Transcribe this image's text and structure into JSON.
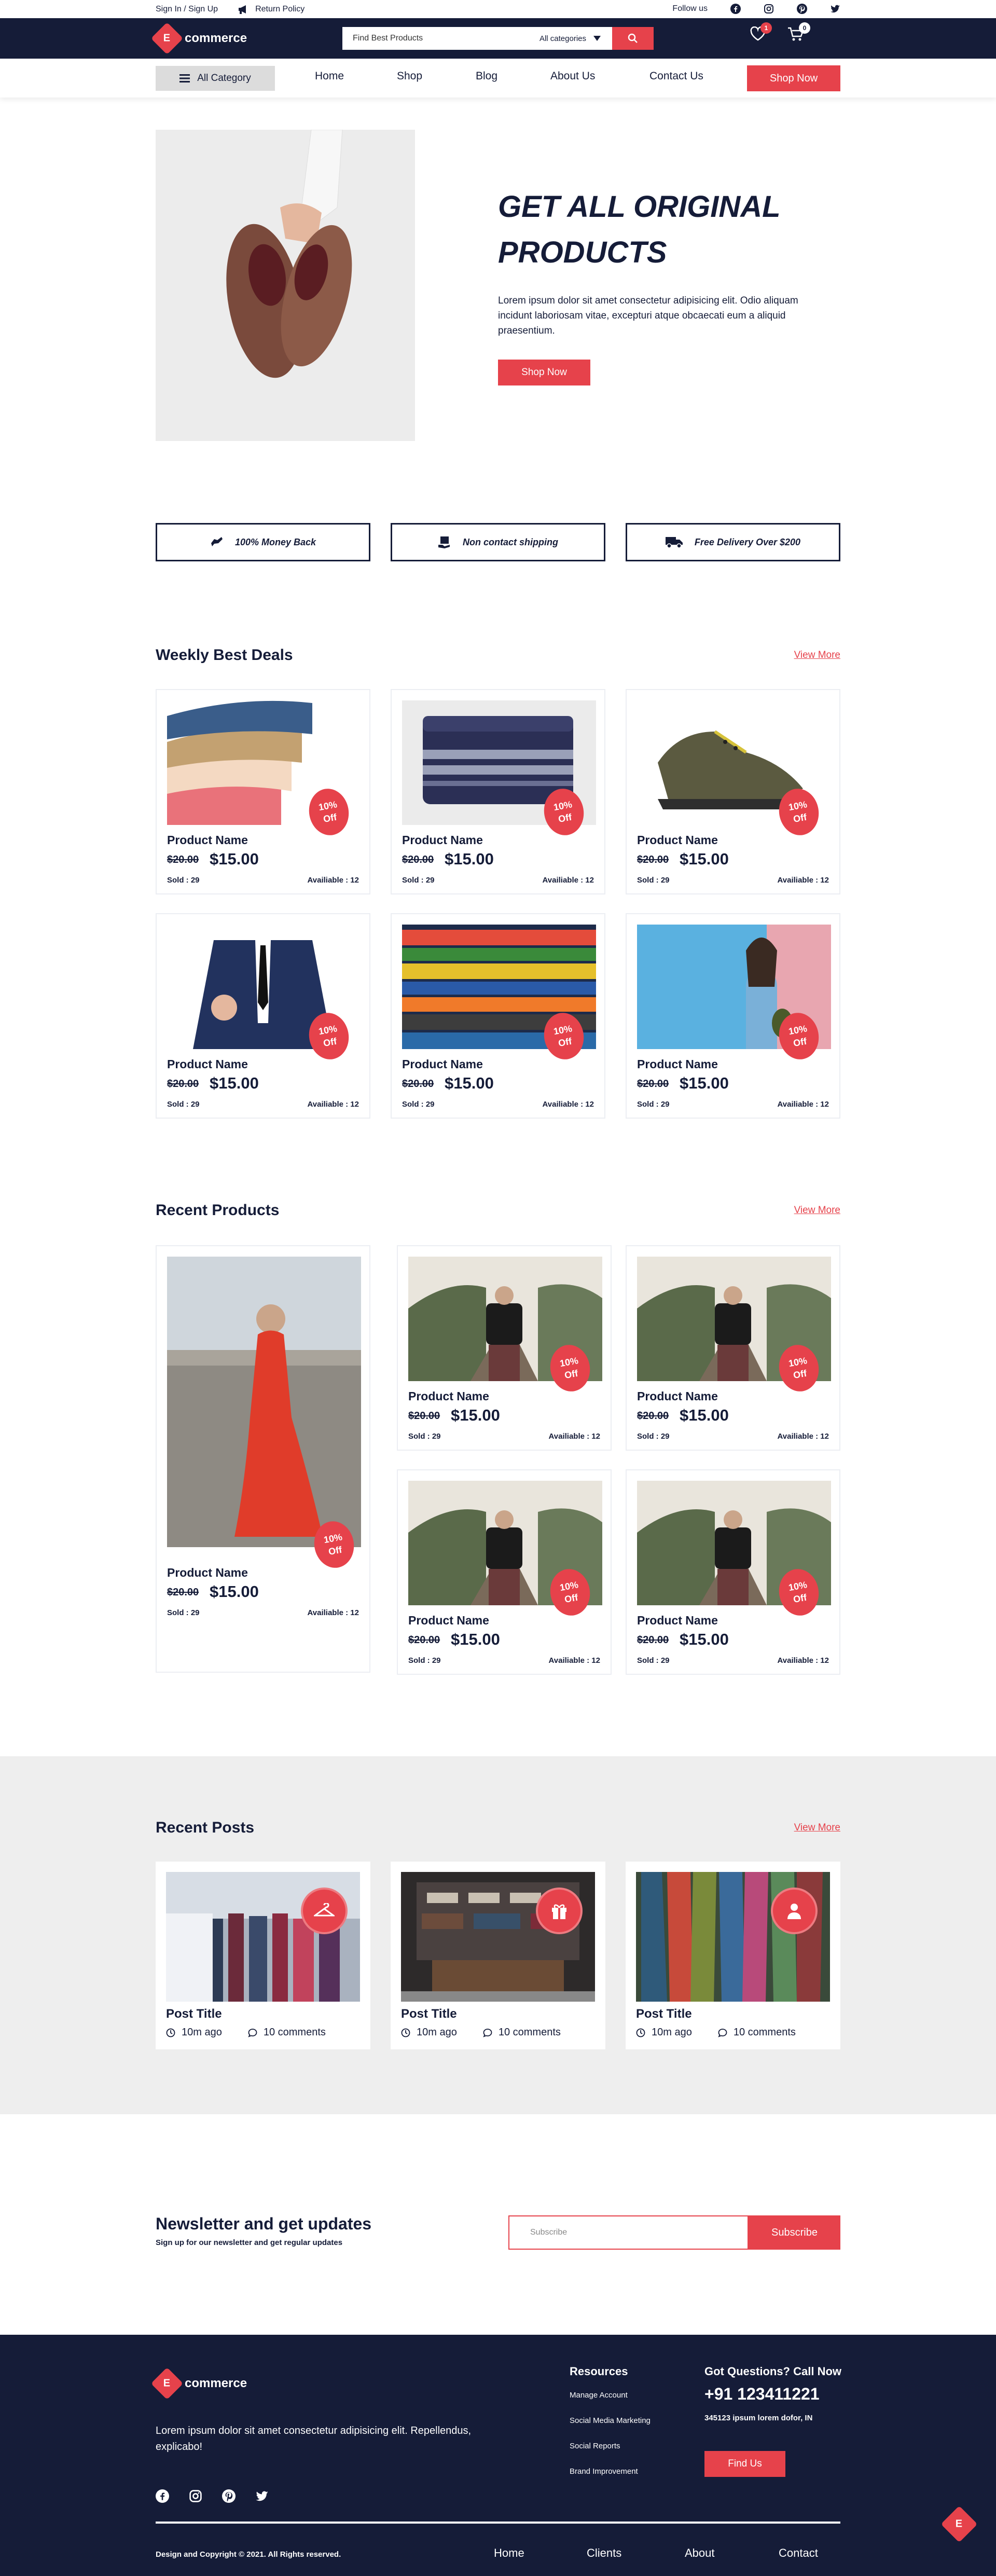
{
  "topbar": {
    "signin": "Sign In / Sign Up",
    "return": "Return Policy",
    "follow": "Follow us"
  },
  "brand": {
    "letter": "E",
    "name": "commerce"
  },
  "search": {
    "placeholder": "Find Best Products",
    "category": "All categories"
  },
  "header": {
    "wishlist_count": "1",
    "cart_count": "0"
  },
  "nav": {
    "all_category": "All Category",
    "links": [
      "Home",
      "Shop",
      "Blog",
      "About Us",
      "Contact Us"
    ],
    "shop_now": "Shop Now"
  },
  "hero": {
    "title_line1": "GET ALL ORIGINAL",
    "title_line2": "PRODUCTS",
    "text": "Lorem ipsum dolor sit amet consectetur adipisicing elit. Odio aliquam incidunt laboriosam vitae, excepturi atque obcaecati eum a aliquid praesentium.",
    "button": "Shop Now"
  },
  "features": [
    "100% Money Back",
    "Non contact shipping",
    "Free Delivery Over $200"
  ],
  "weekly": {
    "title": "Weekly Best Deals",
    "view_more": "View More",
    "product": {
      "name": "Product Name",
      "old_price": "$20.00",
      "price": "$15.00",
      "sold": "Sold : 29",
      "available": "Availiable : 12",
      "off1": "10%",
      "off2": "Off"
    }
  },
  "recent": {
    "title": "Recent Products",
    "view_more": "View More"
  },
  "posts": {
    "title": "Recent Posts",
    "view_more": "View More",
    "post_title": "Post Title",
    "time": "10m ago",
    "comments": "10 comments"
  },
  "newsletter": {
    "title": "Newsletter and get updates",
    "subtitle": "Sign up for our newsletter and get regular updates",
    "placeholder": "Subscribe",
    "button": "Subscribe"
  },
  "footer": {
    "desc": "Lorem ipsum dolor sit amet consectetur adipisicing elit. Repellendus, explicabo!",
    "resources_title": "Resources",
    "resources": [
      "Manage Account",
      "Social Media Marketing",
      "Social Reports",
      "Brand Improvement"
    ],
    "questions_title": "Got Questions? Call Now",
    "phone": "+91 123411221",
    "address": "345123 ipsum lorem dofor, IN",
    "find_us": "Find Us",
    "copyright": "Design and Copyright © 2021. All Rights reserved.",
    "links": [
      "Home",
      "Clients",
      "About",
      "Contact"
    ]
  },
  "colors": {
    "navy": "#151c38",
    "accent": "#e6424b"
  }
}
